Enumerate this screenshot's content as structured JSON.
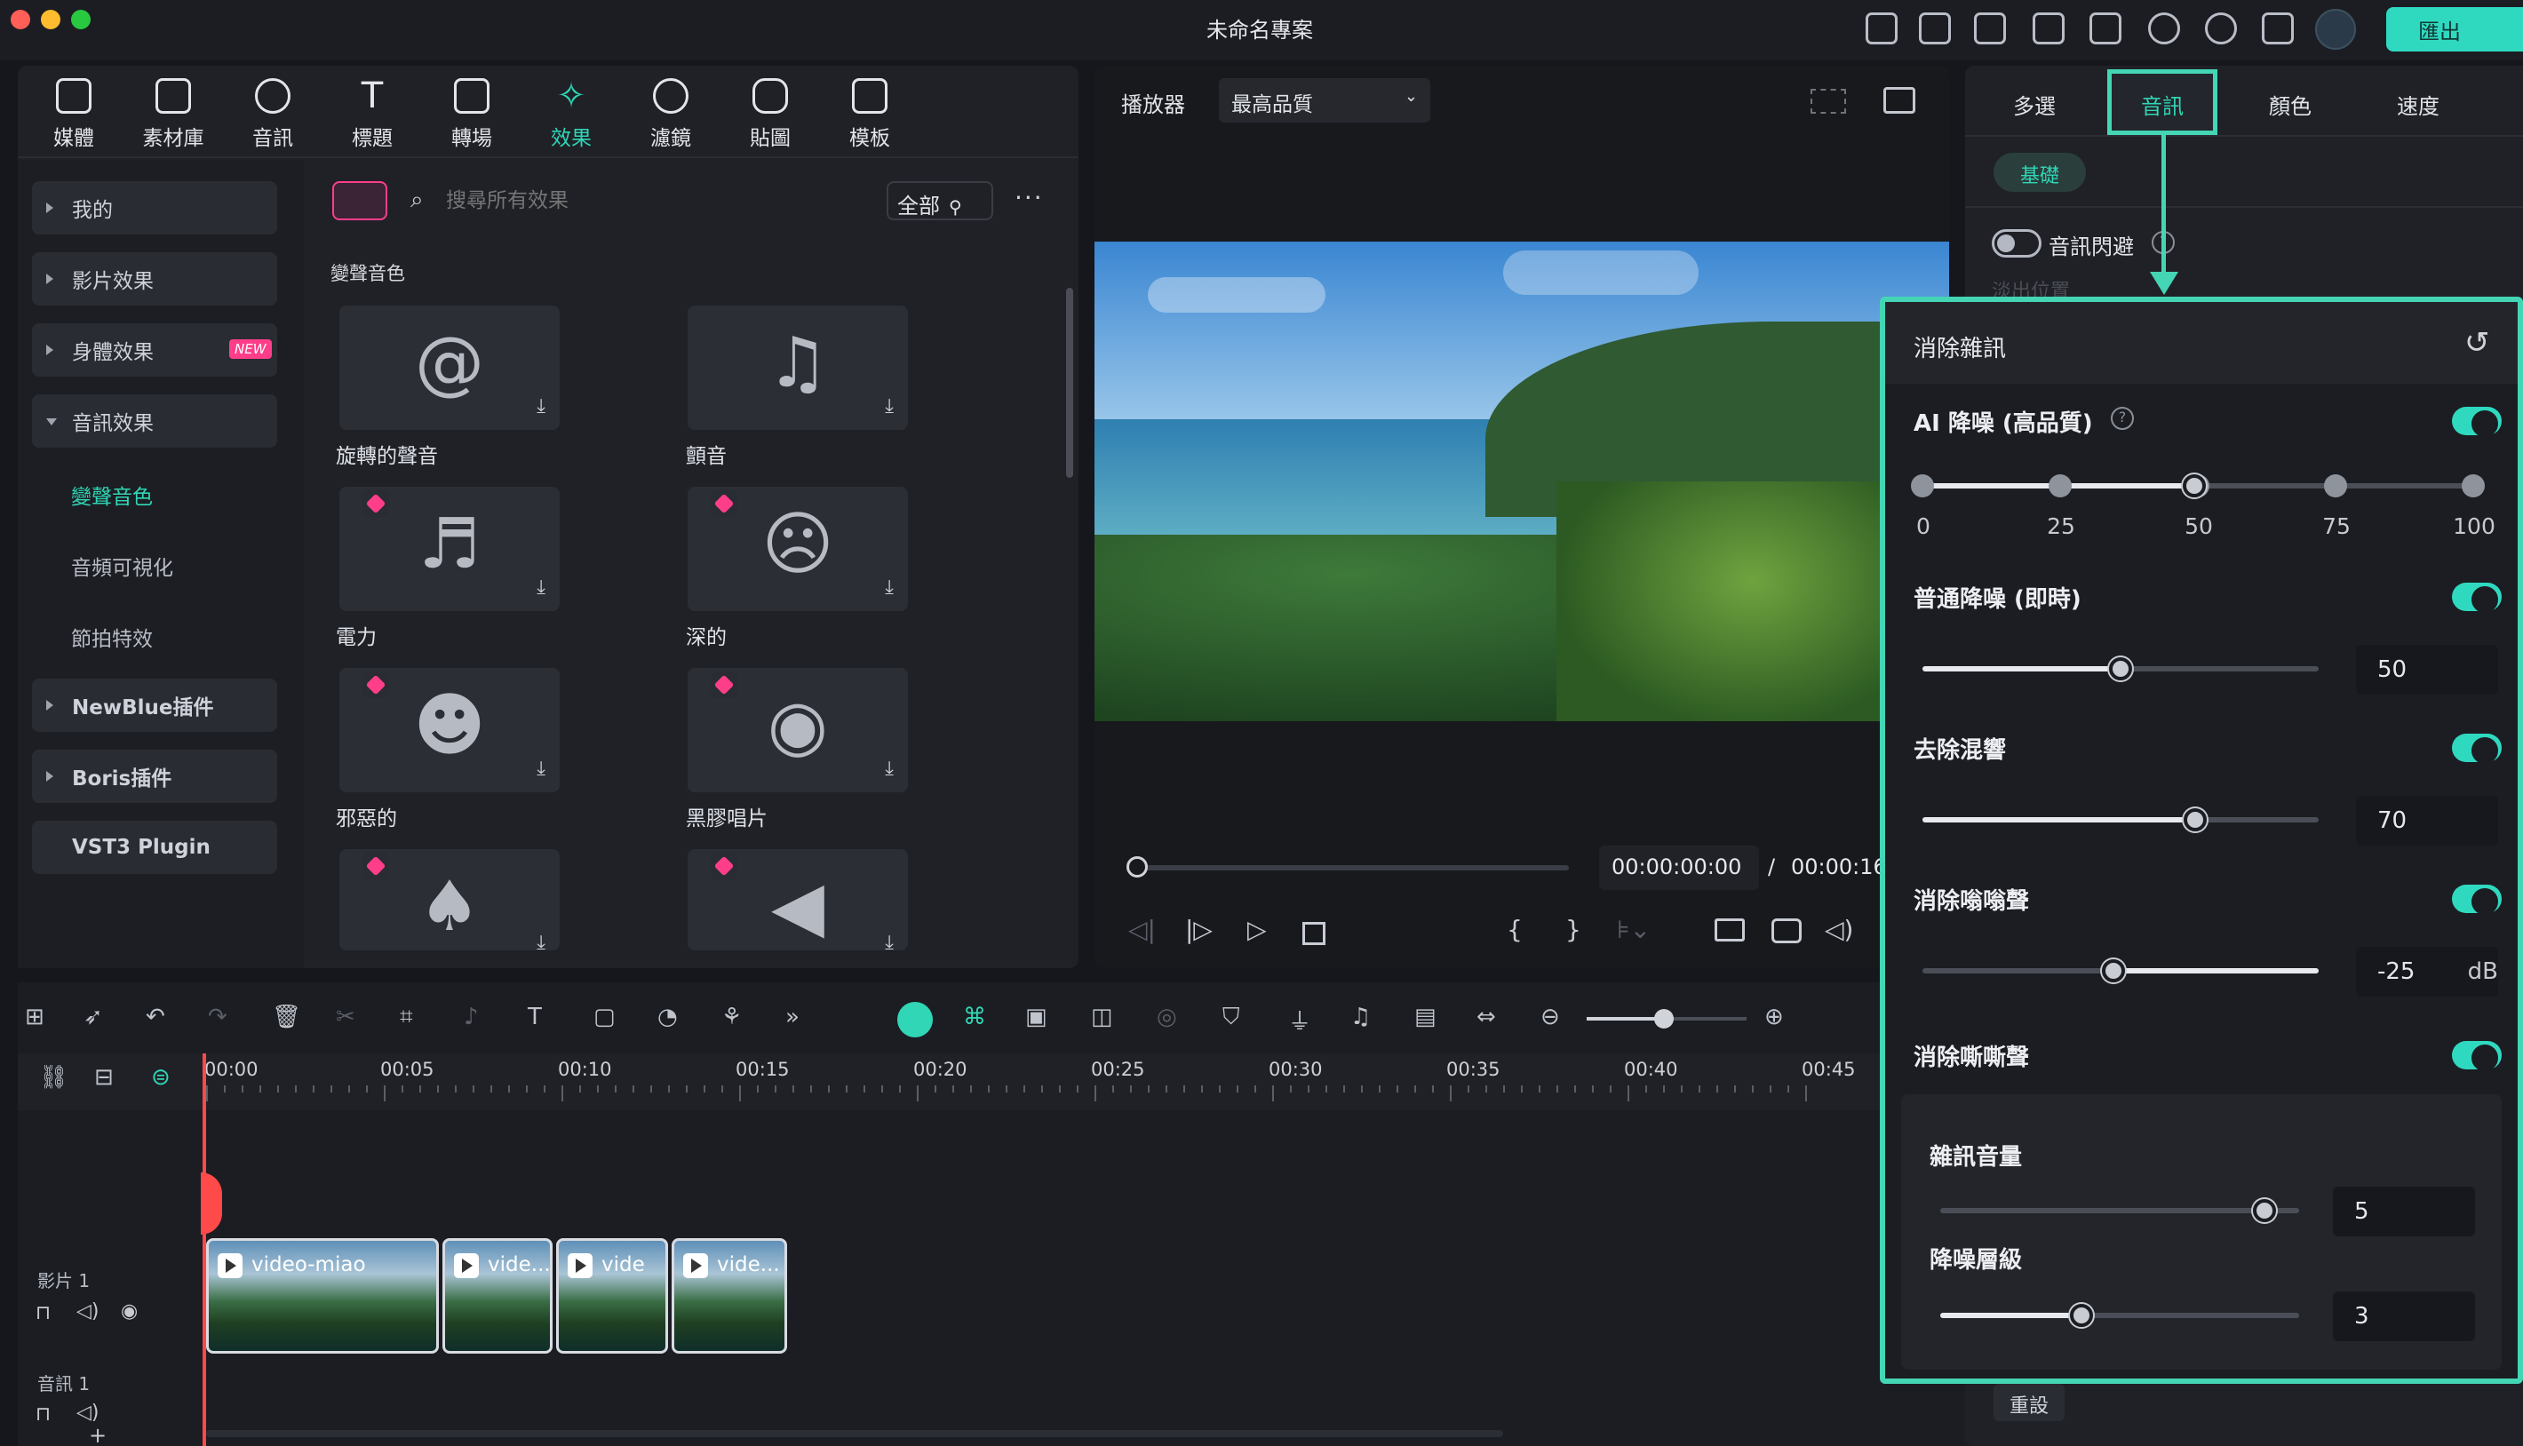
{
  "app": {
    "title": "未命名專案",
    "export": "匯出"
  },
  "toolbar": [
    {
      "label": "媒體"
    },
    {
      "label": "素材庫"
    },
    {
      "label": "音訊"
    },
    {
      "label": "標題"
    },
    {
      "label": "轉場"
    },
    {
      "label": "效果"
    },
    {
      "label": "濾鏡"
    },
    {
      "label": "貼圖"
    },
    {
      "label": "模板"
    }
  ],
  "categories": [
    {
      "label": "我的"
    },
    {
      "label": "影片效果"
    },
    {
      "label": "身體效果",
      "badge": "NEW"
    },
    {
      "label": "音訊效果"
    }
  ],
  "subcategories": [
    {
      "label": "變聲音色"
    },
    {
      "label": "音頻可視化"
    },
    {
      "label": "節拍特效"
    }
  ],
  "plugins": [
    {
      "label": "NewBlue插件"
    },
    {
      "label": "Boris插件"
    },
    {
      "label": "VST3 Plugin"
    }
  ],
  "search": {
    "placeholder": "搜尋所有效果",
    "filter": "全部"
  },
  "section_title": "變聲音色",
  "effects": [
    {
      "label": "旋轉的聲音",
      "icon": "spiral-icon"
    },
    {
      "label": "顫音",
      "icon": "music-notes-icon"
    },
    {
      "label": "電力",
      "icon": "music-note-icon"
    },
    {
      "label": "深的",
      "icon": "sad-face-icon"
    },
    {
      "label": "邪惡的",
      "icon": "devil-face-icon"
    },
    {
      "label": "黑膠唱片",
      "icon": "vinyl-record-icon"
    },
    {
      "label": "",
      "icon": "gramophone-icon"
    },
    {
      "label": "",
      "icon": "megaphone-icon"
    }
  ],
  "player": {
    "label": "播放器",
    "quality": "最高品質",
    "time_current": "00:00:00:00",
    "time_sep": "/",
    "time_total": "00:00:16"
  },
  "timeline": {
    "ticks": [
      "00:00",
      "00:05",
      "00:10",
      "00:15",
      "00:20",
      "00:25",
      "00:30",
      "00:35",
      "00:40",
      "00:45"
    ],
    "track_video": "影片 1",
    "track_audio": "音訊 1",
    "clips": [
      "video-miao",
      "vide...",
      "vide",
      "vide..."
    ]
  },
  "right": {
    "tabs": [
      "多選",
      "音訊",
      "顏色",
      "速度"
    ],
    "basic": "基礎",
    "audio_ducking": "音訊閃避",
    "fade_hint": "淡出位置",
    "denoise_title": "消除雜訊",
    "ai_denoise": "AI 降噪 (高品質)",
    "ai_marks": [
      "0",
      "25",
      "50",
      "75",
      "100"
    ],
    "ai_value": 50,
    "normal_denoise": "普通降噪 (即時)",
    "normal_value": "50",
    "dereverb": "去除混響",
    "dereverb_value": "70",
    "hum": "消除嗡嗡聲",
    "hum_value": "-25",
    "hum_unit": "dB",
    "hiss": "消除嘶嘶聲",
    "noise_volume": "雜訊音量",
    "noise_volume_value": "5",
    "denoise_level": "降噪層級",
    "denoise_level_value": "3",
    "reset": "重設"
  },
  "colors": {
    "accent": "#30d6b6",
    "highlight": "#44d6b4",
    "gem": "#ff3e8a",
    "playhead": "#ff4a4a"
  }
}
